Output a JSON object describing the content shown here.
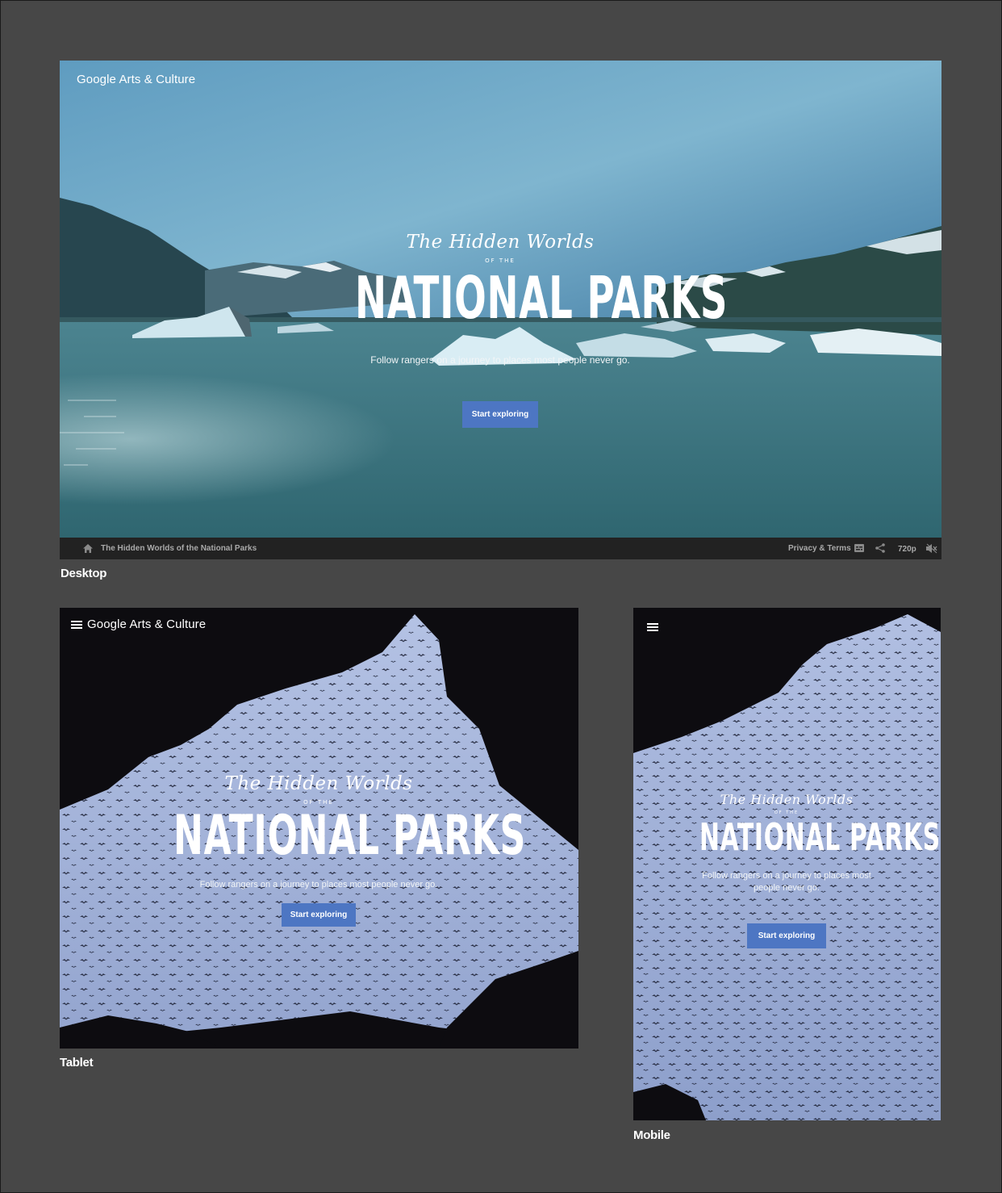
{
  "brand": {
    "google": "Google",
    "product": "Arts & Culture"
  },
  "hero": {
    "script_title": "The Hidden Worlds",
    "of_the": "OF THE",
    "title": "NATIONAL PARKS",
    "subtitle": "Follow rangers on a journey to places most people never go.",
    "subtitle_mobile_line1": "Follow rangers on a journey to places most",
    "subtitle_mobile_line2": "people never go.",
    "cta": "Start exploring"
  },
  "player_bar": {
    "title": "The Hidden Worlds of the National Parks",
    "privacy": "Privacy & Terms",
    "quality": "720p",
    "icons": [
      "home-icon",
      "captions-icon",
      "share-icon",
      "mute-icon"
    ]
  },
  "labels": {
    "desktop": "Desktop",
    "tablet": "Tablet",
    "mobile": "Mobile"
  },
  "colors": {
    "background": "#474747",
    "cta": "#4d76c3",
    "player_bar": "#222222"
  }
}
